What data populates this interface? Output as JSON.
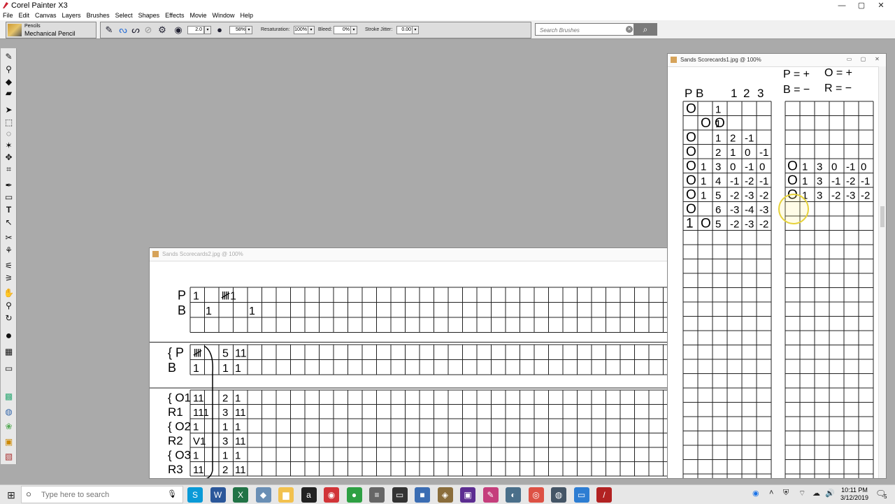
{
  "app": {
    "title": "Corel Painter X3",
    "controls": {
      "minimize": "—",
      "maximize": "▢",
      "close": "✕"
    }
  },
  "menu": [
    "File",
    "Edit",
    "Canvas",
    "Layers",
    "Brushes",
    "Select",
    "Shapes",
    "Effects",
    "Movie",
    "Window",
    "Help"
  ],
  "property_bar": {
    "brush_category": "Pencils",
    "brush_variant": "Mechanical Pencil",
    "size_value": "2.0",
    "opacity_value": "58%",
    "resaturation_label": "Resaturation:",
    "resaturation_value": "100%",
    "bleed_label": "Bleed:",
    "bleed_value": "0%",
    "stroke_jitter_label": "Stroke Jitter:",
    "stroke_jitter_value": "0.00",
    "search_placeholder": "Search Brushes"
  },
  "documents": {
    "scorecards1": {
      "title": "Sands Scorecards1.jpg @ 100%",
      "header_top": [
        "P = +",
        "O = +",
        "B = −",
        "R = −"
      ],
      "left_header": [
        "P",
        "B",
        "1",
        "2",
        "3"
      ],
      "left_rows": [
        [
          "O",
          "",
          "1",
          "",
          "",
          ""
        ],
        [
          "",
          "O O",
          "1",
          "",
          "",
          ""
        ],
        [
          "O",
          "",
          "1",
          "2",
          "-1",
          ""
        ],
        [
          "O",
          "",
          "2",
          "1",
          "0",
          "-1"
        ],
        [
          "O",
          "1",
          "3",
          "0",
          "-1",
          "0"
        ],
        [
          "O",
          "1",
          "4",
          "-1",
          "-2",
          "-1"
        ],
        [
          "O",
          "1",
          "5",
          "-2",
          "-3",
          "-2"
        ],
        [
          "O",
          "",
          "6",
          "-3",
          "-4",
          "-3"
        ],
        [
          "1",
          "O",
          "5",
          "-2",
          "-3",
          "-2"
        ]
      ],
      "right_rows": [
        [
          "O",
          "1",
          "3",
          "0",
          "-1",
          "0"
        ],
        [
          "O",
          "1",
          "3",
          "-1",
          "-2",
          "-1"
        ],
        [
          "O",
          "1",
          "3",
          "-2",
          "-3",
          "-2"
        ]
      ]
    },
    "scorecards2": {
      "title": "Sands Scorecards2.jpg @ 100%",
      "rows_top": [
        {
          "label": "P",
          "tally1": "1",
          "tally2": "𝍸1"
        },
        {
          "label": "B",
          "tally1": "1",
          "tally2": "1"
        }
      ],
      "rows_mid": [
        {
          "label": "{ P",
          "tally1": "𝍸",
          "count": "5",
          "tally2": "11"
        },
        {
          "label": "  B",
          "tally1": "1",
          "count": "1",
          "tally2": "1"
        }
      ],
      "rows_low": [
        {
          "label": "{ O1",
          "tally1": "11",
          "count": "2",
          "tally2": "1"
        },
        {
          "label": "  R1",
          "tally1": "111",
          "count": "3",
          "tally2": "11"
        },
        {
          "label": "{ O2",
          "tally1": "1",
          "count": "1",
          "tally2": "1"
        },
        {
          "label": "  R2",
          "tally1": "V1",
          "count": "3",
          "tally2": "11"
        },
        {
          "label": "{ O3",
          "tally1": "1",
          "count": "1",
          "tally2": "1"
        },
        {
          "label": "  R3",
          "tally1": "11",
          "count": "2",
          "tally2": "11"
        }
      ]
    }
  },
  "taskbar": {
    "search_placeholder": "Type here to search",
    "time": "10:11 PM",
    "date": "3/12/2019",
    "notification_count": "5",
    "apps": [
      {
        "name": "skype",
        "glyph": "S",
        "color": "#0a9ad7"
      },
      {
        "name": "word",
        "glyph": "W",
        "color": "#2b579a"
      },
      {
        "name": "excel",
        "glyph": "X",
        "color": "#217346"
      },
      {
        "name": "app-blue",
        "glyph": "◆",
        "color": "#6a8fb5"
      },
      {
        "name": "explorer",
        "glyph": "▆",
        "color": "#f2c14e"
      },
      {
        "name": "amazon",
        "glyph": "a",
        "color": "#222222"
      },
      {
        "name": "app-red",
        "glyph": "◉",
        "color": "#d13438"
      },
      {
        "name": "app-green",
        "glyph": "●",
        "color": "#2ea043"
      },
      {
        "name": "app-gray",
        "glyph": "≡",
        "color": "#666666"
      },
      {
        "name": "terminal",
        "glyph": "▭",
        "color": "#333333"
      },
      {
        "name": "app-blue2",
        "glyph": "■",
        "color": "#3b6db3"
      },
      {
        "name": "app-stack",
        "glyph": "◈",
        "color": "#8a6d3b"
      },
      {
        "name": "app-purple",
        "glyph": "▣",
        "color": "#5c2d91"
      },
      {
        "name": "app-pink",
        "glyph": "✎",
        "color": "#c53e7c"
      },
      {
        "name": "app-fish",
        "glyph": "◐",
        "color": "#4a6f8a"
      },
      {
        "name": "chrome",
        "glyph": "◎",
        "color": "#dd5144"
      },
      {
        "name": "app-circle",
        "glyph": "◍",
        "color": "#445566"
      },
      {
        "name": "app-window",
        "glyph": "▭",
        "color": "#2d7dd2"
      },
      {
        "name": "painter",
        "glyph": "/",
        "color": "#b22222"
      }
    ]
  }
}
